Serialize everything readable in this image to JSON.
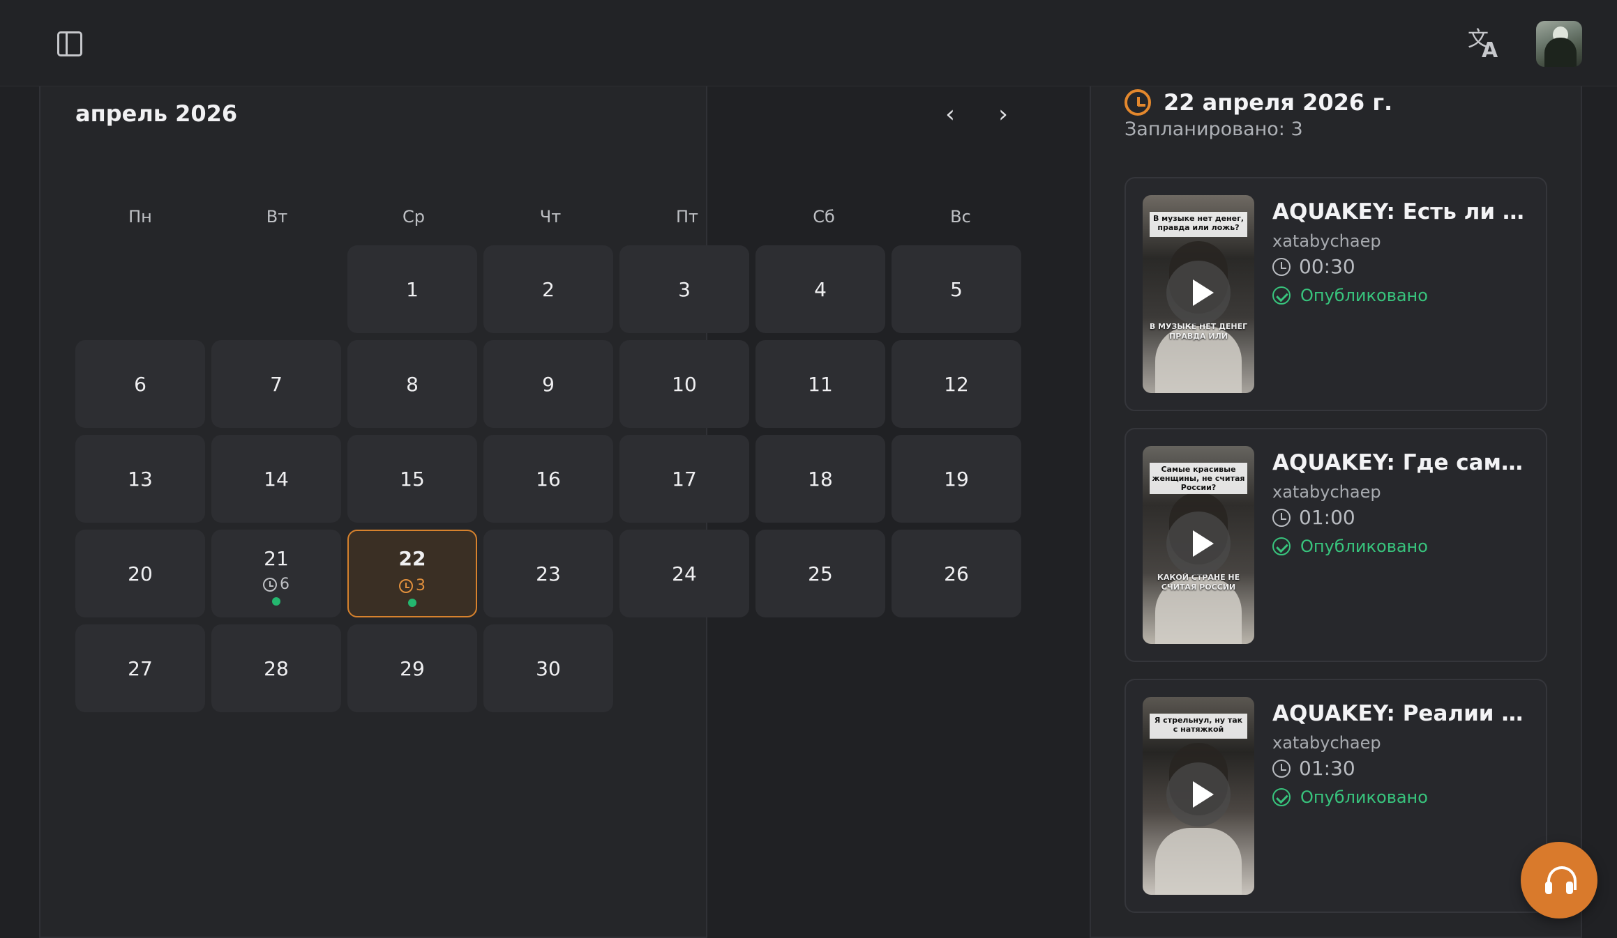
{
  "calendar": {
    "month_title": "апрель 2026",
    "weekdays": [
      "Пн",
      "Вт",
      "Ср",
      "Чт",
      "Пт",
      "Сб",
      "Вс"
    ],
    "days": [
      {
        "day": "",
        "empty": true
      },
      {
        "day": "",
        "empty": true
      },
      {
        "day": "1"
      },
      {
        "day": "2"
      },
      {
        "day": "3"
      },
      {
        "day": "4"
      },
      {
        "day": "5"
      },
      {
        "day": "6"
      },
      {
        "day": "7"
      },
      {
        "day": "8"
      },
      {
        "day": "9"
      },
      {
        "day": "10"
      },
      {
        "day": "11"
      },
      {
        "day": "12"
      },
      {
        "day": "13"
      },
      {
        "day": "14"
      },
      {
        "day": "15"
      },
      {
        "day": "16"
      },
      {
        "day": "17"
      },
      {
        "day": "18"
      },
      {
        "day": "19"
      },
      {
        "day": "20"
      },
      {
        "day": "21",
        "events": "6",
        "dot": true
      },
      {
        "day": "22",
        "events": "3",
        "dot": true,
        "selected": true
      },
      {
        "day": "23"
      },
      {
        "day": "24"
      },
      {
        "day": "25"
      },
      {
        "day": "26"
      },
      {
        "day": "27"
      },
      {
        "day": "28"
      },
      {
        "day": "29"
      },
      {
        "day": "30"
      }
    ]
  },
  "schedule": {
    "date": "22 апреля 2026 г.",
    "scheduled_count": "Запланировано: 3",
    "videos": [
      {
        "title": "AQUAKEY: Есть ли де...",
        "channel": "xatabychaep",
        "time": "00:30",
        "status": "Опубликовано",
        "thumb_top": "В музыке нет денег, правда или ложь?",
        "thumb_bottom": "В МУЗЫКЕ НЕТ ДЕНЕГ ПРАВДА ИЛИ"
      },
      {
        "title": "AQUAKEY: Где самы...",
        "channel": "xatabychaep",
        "time": "01:00",
        "status": "Опубликовано",
        "thumb_top": "Самые красивые женщины, не считая России?",
        "thumb_bottom": "КАКОЙ СТРАНЕ НЕ СЧИТАЯ РОССИИ"
      },
      {
        "title": "AQUAKEY: Реалии му...",
        "channel": "xatabychaep",
        "time": "01:30",
        "status": "Опубликовано",
        "thumb_top": "Я стрельнул, ну так с натяжкой",
        "thumb_bottom": ""
      }
    ]
  },
  "colors": {
    "background": "#202124",
    "panel": "#252629",
    "accent": "#d97a2c",
    "success": "#38c47d"
  }
}
